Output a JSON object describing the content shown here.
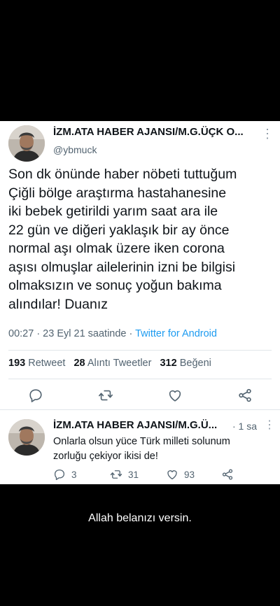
{
  "tweet": {
    "display_name": "İZM.ATA HABER AJANSI/M.G.ÜÇK O...",
    "handle": "@ybmuck",
    "text": "Son dk önünde haber nöbeti tuttuğum\nÇiğli bölge araştırma hastahanesine\niki bebek getirildi yarım saat ara ile\n22 gün ve diğeri yaklaşık bir ay önce\nnormal aşı olmak üzere iken  corona\naşısı olmuşlar ailelerinin izni be bilgisi\nolmaksızın ve sonuç yoğun bakıma\nalındılar! Duanız",
    "timestamp": "00:27 · 23 Eyl 21 saatinde · ",
    "source": "Twitter for Android",
    "stats": {
      "retweets_count": "193",
      "retweets_label": "Retweet",
      "quotes_count": "28",
      "quotes_label": "Alıntı Tweetler",
      "likes_count": "312",
      "likes_label": "Beğeni"
    }
  },
  "reply": {
    "display_name": "İZM.ATA HABER AJANSI/M.G.Ü...",
    "time": "· 1 sa",
    "text": "Onlarla olsun yüce Türk milleti solunum\nzorluğu çekiyor ikisi de!",
    "reply_count": "3",
    "retweet_count": "31",
    "like_count": "93"
  },
  "caption": "Allah belanızı versin.",
  "icons": {
    "more": "more-options-icon",
    "reply": "reply-icon",
    "retweet": "retweet-icon",
    "like": "heart-icon",
    "share": "share-icon"
  },
  "colors": {
    "link": "#1d9bf0",
    "secondary_text": "#536471",
    "background": "#000000"
  }
}
